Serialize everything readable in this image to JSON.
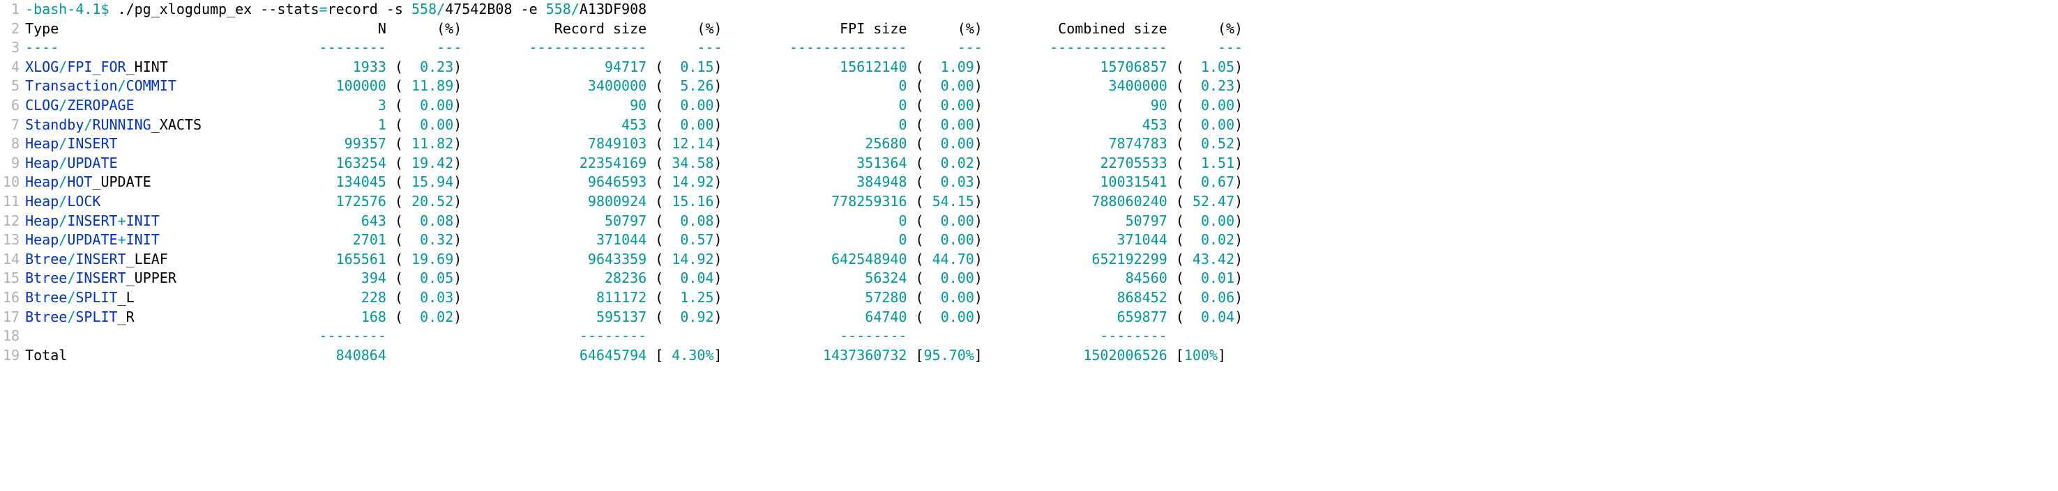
{
  "prompt": {
    "pre": "-bash-",
    "ver": "4.1",
    "dollar": "$ "
  },
  "cmd": {
    "c1": "./pg_xlogdump_ex --stats",
    "eq": "=",
    "c2": "record -s",
    "a1": " 558",
    "slash1": "/",
    "a2": "47542B08 -e",
    "a3": " 558",
    "slash2": "/",
    "a4": "A13DF908"
  },
  "header": {
    "type": "Type",
    "n": "N",
    "pctN": "(%)",
    "rsize": "Record size",
    "pctR": "(%)",
    "fsize": "FPI size",
    "pctF": "(%)",
    "csize": "Combined size",
    "pctC": "(%)"
  },
  "sep": {
    "d4": "----",
    "d8": "--------",
    "d14": "--------------",
    "d3": "---"
  },
  "rows": [
    {
      "t1": "XLOG",
      "ts": "/",
      "t2": "FPI_FOR",
      "t3": "_HINT",
      "n": "1933",
      "np": "0.23",
      "r": "94717",
      "rp": "0.15",
      "f": "15612140",
      "fp": "1.09",
      "c": "15706857",
      "cp": "1.05"
    },
    {
      "t1": "Transaction",
      "ts": "/",
      "t2": "COMMIT",
      "t3": "",
      "n": "100000",
      "np": "11.89",
      "r": "3400000",
      "rp": "5.26",
      "f": "0",
      "fp": "0.00",
      "c": "3400000",
      "cp": "0.23"
    },
    {
      "t1": "CLOG",
      "ts": "/",
      "t2": "ZEROPAGE",
      "t3": "",
      "n": "3",
      "np": "0.00",
      "r": "90",
      "rp": "0.00",
      "f": "0",
      "fp": "0.00",
      "c": "90",
      "cp": "0.00"
    },
    {
      "t1": "Standby",
      "ts": "/",
      "t2": "RUNNING",
      "t3": "_XACTS",
      "n": "1",
      "np": "0.00",
      "r": "453",
      "rp": "0.00",
      "f": "0",
      "fp": "0.00",
      "c": "453",
      "cp": "0.00"
    },
    {
      "t1": "Heap",
      "ts": "/",
      "t2": "INSERT",
      "t3": "",
      "n": "99357",
      "np": "11.82",
      "r": "7849103",
      "rp": "12.14",
      "f": "25680",
      "fp": "0.00",
      "c": "7874783",
      "cp": "0.52"
    },
    {
      "t1": "Heap",
      "ts": "/",
      "t2": "UPDATE",
      "t3": "",
      "n": "163254",
      "np": "19.42",
      "r": "22354169",
      "rp": "34.58",
      "f": "351364",
      "fp": "0.02",
      "c": "22705533",
      "cp": "1.51"
    },
    {
      "t1": "Heap",
      "ts": "/",
      "t2": "HOT",
      "t3": "_UPDATE",
      "n": "134045",
      "np": "15.94",
      "r": "9646593",
      "rp": "14.92",
      "f": "384948",
      "fp": "0.03",
      "c": "10031541",
      "cp": "0.67"
    },
    {
      "t1": "Heap",
      "ts": "/",
      "t2": "LOCK",
      "t3": "",
      "n": "172576",
      "np": "20.52",
      "r": "9800924",
      "rp": "15.16",
      "f": "778259316",
      "fp": "54.15",
      "c": "788060240",
      "cp": "52.47"
    },
    {
      "t1": "Heap",
      "ts": "/",
      "t2": "INSERT",
      "t3p": "+",
      "t3": "INIT",
      "n": "643",
      "np": "0.08",
      "r": "50797",
      "rp": "0.08",
      "f": "0",
      "fp": "0.00",
      "c": "50797",
      "cp": "0.00"
    },
    {
      "t1": "Heap",
      "ts": "/",
      "t2": "UPDATE",
      "t3p": "+",
      "t3": "INIT",
      "n": "2701",
      "np": "0.32",
      "r": "371044",
      "rp": "0.57",
      "f": "0",
      "fp": "0.00",
      "c": "371044",
      "cp": "0.02"
    },
    {
      "t1": "Btree",
      "ts": "/",
      "t2": "INSERT",
      "t3": "_LEAF",
      "n": "165561",
      "np": "19.69",
      "r": "9643359",
      "rp": "14.92",
      "f": "642548940",
      "fp": "44.70",
      "c": "652192299",
      "cp": "43.42"
    },
    {
      "t1": "Btree",
      "ts": "/",
      "t2": "INSERT",
      "t3": "_UPPER",
      "n": "394",
      "np": "0.05",
      "r": "28236",
      "rp": "0.04",
      "f": "56324",
      "fp": "0.00",
      "c": "84560",
      "cp": "0.01"
    },
    {
      "t1": "Btree",
      "ts": "/",
      "t2": "SPLIT",
      "t3": "_L",
      "n": "228",
      "np": "0.03",
      "r": "811172",
      "rp": "1.25",
      "f": "57280",
      "fp": "0.00",
      "c": "868452",
      "cp": "0.06"
    },
    {
      "t1": "Btree",
      "ts": "/",
      "t2": "SPLIT",
      "t3": "_R",
      "n": "168",
      "np": "0.02",
      "r": "595137",
      "rp": "0.92",
      "f": "64740",
      "fp": "0.00",
      "c": "659877",
      "cp": "0.04"
    }
  ],
  "total": {
    "label": "Total",
    "n": "840864",
    "r": "64645794",
    "rp": "4.30%",
    "f": "1437360732",
    "fp": "95.70%",
    "c": "1502006526",
    "cp": "100%"
  },
  "ln": [
    "1",
    "2",
    "3",
    "4",
    "5",
    "6",
    "7",
    "8",
    "9",
    "10",
    "11",
    "12",
    "13",
    "14",
    "15",
    "16",
    "17",
    "18",
    "19"
  ],
  "widths": {
    "type": 33,
    "n": 10,
    "tp": 8,
    "r": 22,
    "rp": 8,
    "f": 22,
    "fp": 8,
    "c": 22,
    "cp": 8
  }
}
